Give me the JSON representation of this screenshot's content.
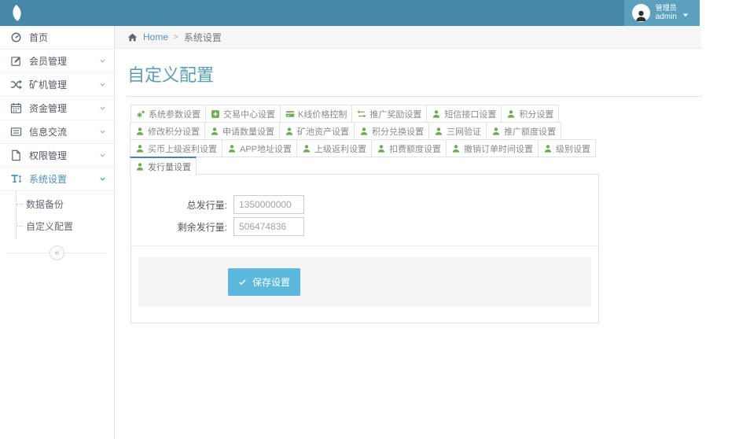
{
  "header": {
    "user": {
      "role": "管理员",
      "name": "admin"
    }
  },
  "sidebar": {
    "items": [
      {
        "label": "首页",
        "icon": "dashboard-icon"
      },
      {
        "label": "会员管理",
        "icon": "edit-icon"
      },
      {
        "label": "矿机管理",
        "icon": "shuffle-icon"
      },
      {
        "label": "资金管理",
        "icon": "calendar-icon"
      },
      {
        "label": "信息交流",
        "icon": "message-icon"
      },
      {
        "label": "权限管理",
        "icon": "file-icon"
      },
      {
        "label": "系统设置",
        "icon": "text-height-icon",
        "active": true
      }
    ],
    "submenu": [
      {
        "label": "数据备份"
      },
      {
        "label": "自定义配置",
        "active": true
      }
    ],
    "collapse_glyph": "«"
  },
  "breadcrumb": {
    "home": "Home",
    "separator": ">",
    "current": "系统设置"
  },
  "page": {
    "title": "自定义配置"
  },
  "tabs": {
    "items": [
      {
        "label": "系统参数设置",
        "icon": "cogs-icon"
      },
      {
        "label": "交易中心设置",
        "icon": "plus-square-icon"
      },
      {
        "label": "K线价格控制",
        "icon": "credit-card-icon"
      },
      {
        "label": "推广奖励设置",
        "icon": "exchange-icon"
      },
      {
        "label": "短信接口设置",
        "icon": "user-icon"
      },
      {
        "label": "积分设置",
        "icon": "user-icon"
      },
      {
        "label": "修改积分设置",
        "icon": "user-icon"
      },
      {
        "label": "申请数量设置",
        "icon": "user-icon"
      },
      {
        "label": "矿池资产设置",
        "icon": "user-icon"
      },
      {
        "label": "积分兑换设置",
        "icon": "user-icon"
      },
      {
        "label": "三网验证",
        "icon": "user-icon"
      },
      {
        "label": "推广额度设置",
        "icon": "user-icon"
      },
      {
        "label": "买币上级返利设置",
        "icon": "user-icon"
      },
      {
        "label": "APP地址设置",
        "icon": "user-icon"
      },
      {
        "label": "上级返利设置",
        "icon": "user-icon"
      },
      {
        "label": "扣费额度设置",
        "icon": "user-icon"
      },
      {
        "label": "撤销订单时间设置",
        "icon": "user-icon"
      },
      {
        "label": "级别设置",
        "icon": "user-icon"
      },
      {
        "label": "发行量设置",
        "icon": "user-icon",
        "active": true
      }
    ]
  },
  "form": {
    "fields": [
      {
        "label": "总发行量:",
        "value": "1350000000"
      },
      {
        "label": "剩余发行量:",
        "value": "506474836"
      }
    ],
    "save_label": "保存设置"
  },
  "colors": {
    "header_bg": "#4788a8",
    "user_bg": "#5ba0bd",
    "green": "#6bad4e",
    "button_bg": "#5bb7dc",
    "tab_active_border": "#4d82b0",
    "title_color": "#5b9db8",
    "link_color": "#5293c8",
    "sidebar_active": "#4a90b5"
  }
}
